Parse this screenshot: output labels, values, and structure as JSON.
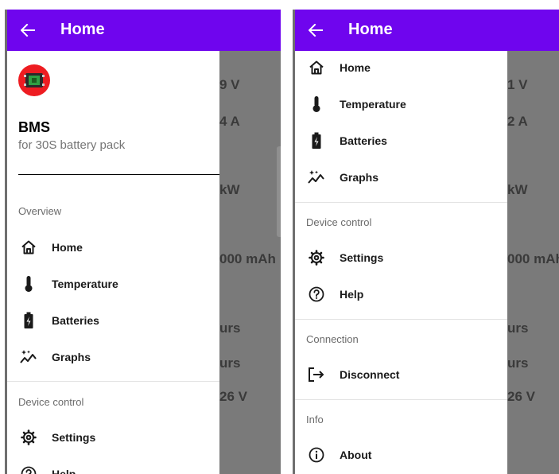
{
  "colors": {
    "appbar": "#6f05ee",
    "scrim": "#7a7a7a",
    "logo": "#ee1c21",
    "icon": "#1a1a1a"
  },
  "left": {
    "appbar": {
      "title": "Home",
      "back_icon": "arrow-left-icon"
    },
    "background_values": [
      "9 V",
      "4 A",
      "kW",
      "000 mAh",
      "urs",
      "urs",
      "26 V"
    ],
    "header": {
      "logo_icon": "bms-board-icon",
      "title": "BMS",
      "subtitle": "for 30S battery pack"
    },
    "sections": [
      {
        "label": "Overview",
        "items": [
          {
            "label": "Home",
            "icon": "home-icon"
          },
          {
            "label": "Temperature",
            "icon": "thermometer-icon"
          },
          {
            "label": "Batteries",
            "icon": "battery-charging-icon"
          },
          {
            "label": "Graphs",
            "icon": "sparkle-graph-icon"
          }
        ]
      },
      {
        "label": "Device control",
        "items": [
          {
            "label": "Settings",
            "icon": "gear-icon"
          },
          {
            "label": "Help",
            "icon": "help-icon"
          }
        ]
      }
    ]
  },
  "right": {
    "appbar": {
      "title": "Home",
      "back_icon": "arrow-left-icon"
    },
    "background_values": [
      "1 V",
      "2 A",
      "kW",
      "000 mAh",
      "urs",
      "urs",
      "26 V"
    ],
    "top_items": [
      {
        "label": "Home",
        "icon": "home-icon"
      },
      {
        "label": "Temperature",
        "icon": "thermometer-icon"
      },
      {
        "label": "Batteries",
        "icon": "battery-charging-icon"
      },
      {
        "label": "Graphs",
        "icon": "sparkle-graph-icon"
      }
    ],
    "sections": [
      {
        "label": "Device control",
        "items": [
          {
            "label": "Settings",
            "icon": "gear-icon"
          },
          {
            "label": "Help",
            "icon": "help-icon"
          }
        ]
      },
      {
        "label": "Connection",
        "items": [
          {
            "label": "Disconnect",
            "icon": "logout-icon"
          }
        ]
      },
      {
        "label": "Info",
        "items": [
          {
            "label": "About",
            "icon": "info-icon"
          }
        ]
      }
    ]
  }
}
